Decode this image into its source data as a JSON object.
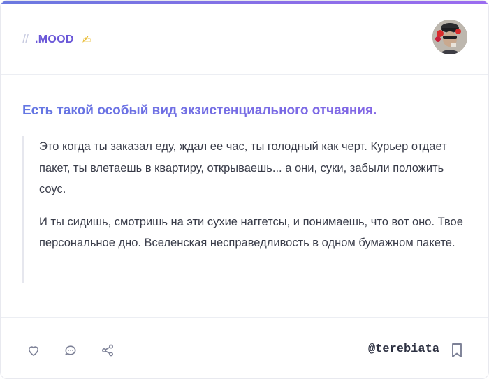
{
  "header": {
    "slashes": "//",
    "tag_label": ".MOOD",
    "tag_emoji": "✍"
  },
  "post": {
    "title": "Есть такой особый вид экзистенциального отчаяния.",
    "paragraphs": [
      "Это когда ты заказал еду, ждал ее час, ты голодный как черт. Курьер отдает пакет, ты влетаешь в квартиру, открываешь... а они, суки, забыли положить соус.",
      "И ты сидишь, смотришь на эти сухие наггетсы, и понимаешь, что вот оно. Твое персональное дно. Вселенская несправедливость в одном бумажном пакете."
    ]
  },
  "footer": {
    "author_handle": "@terebiata"
  },
  "colors": {
    "accent": "#7a5fe0",
    "icon": "#7c8096"
  }
}
